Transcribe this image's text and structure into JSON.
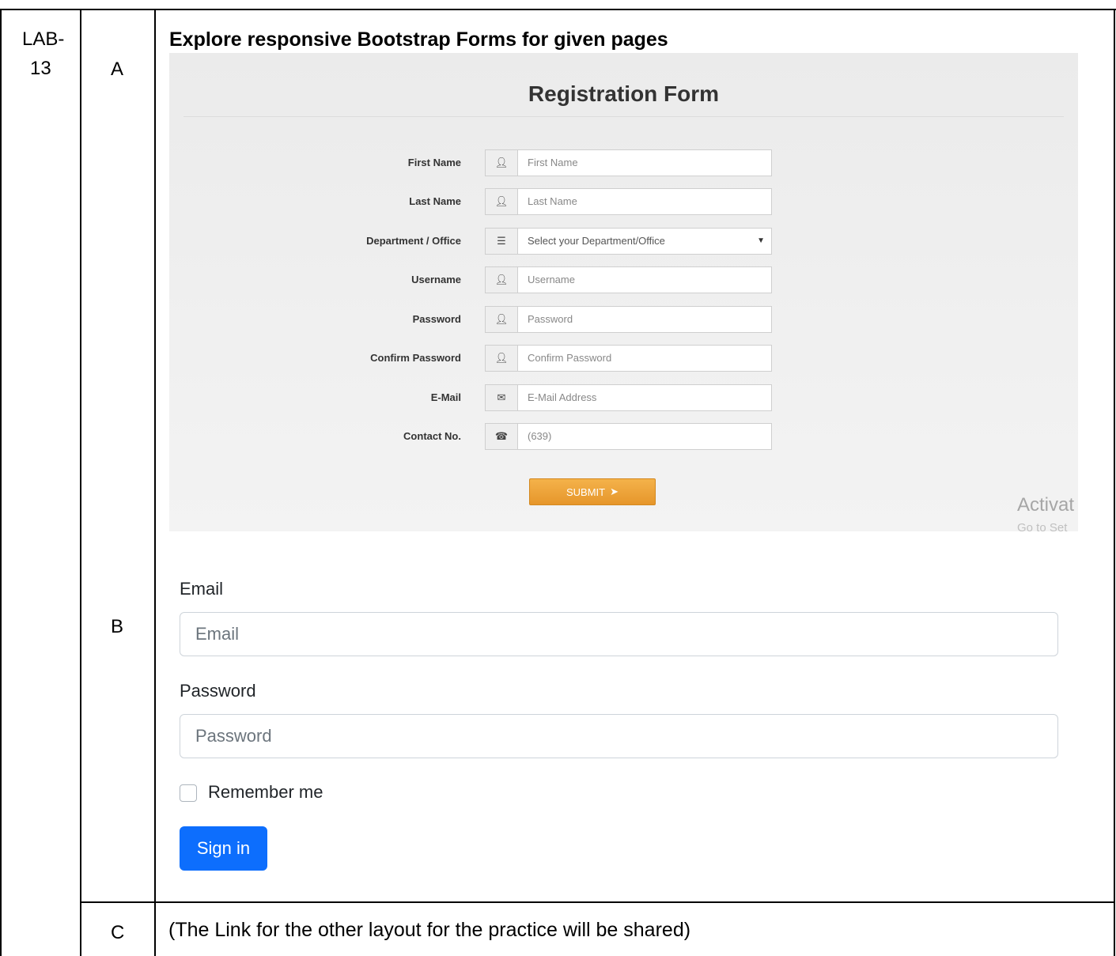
{
  "table": {
    "lab_label": "LAB-",
    "lab_number": "13",
    "part_a": "A",
    "part_b": "B",
    "part_c": "C"
  },
  "heading": "Explore responsive Bootstrap Forms for given pages",
  "registration_form": {
    "title": "Registration Form",
    "fields": [
      {
        "label": "First Name",
        "icon": "user-icon",
        "placeholder": "First Name"
      },
      {
        "label": "Last Name",
        "icon": "user-icon",
        "placeholder": "Last Name"
      },
      {
        "label": "Department / Office",
        "icon": "list-icon",
        "placeholder": "Select your Department/Office"
      },
      {
        "label": "Username",
        "icon": "user-icon",
        "placeholder": "Username"
      },
      {
        "label": "Password",
        "icon": "user-icon",
        "placeholder": "Password"
      },
      {
        "label": "Confirm Password",
        "icon": "user-icon",
        "placeholder": "Confirm Password"
      },
      {
        "label": "E-Mail",
        "icon": "envelope-icon",
        "placeholder": "E-Mail Address"
      },
      {
        "label": "Contact No.",
        "icon": "phone-icon",
        "placeholder": "(639)"
      }
    ],
    "submit_label": "SUBMIT",
    "watermark_line1": "Activat",
    "watermark_line2": "Go to Set"
  },
  "signin_form": {
    "email_label": "Email",
    "email_placeholder": "Email",
    "password_label": "Password",
    "password_placeholder": "Password",
    "remember_label": "Remember me",
    "signin_button": "Sign in"
  },
  "part_c_text": "(The Link for the other layout for the practice will be shared)"
}
